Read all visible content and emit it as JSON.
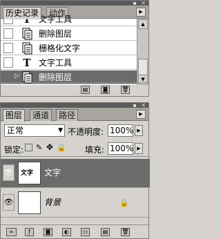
{
  "history": {
    "tabs": [
      "历史记录",
      "动作"
    ],
    "items": [
      {
        "label": "文字工具",
        "icon": "type-tool-icon",
        "selected": false
      },
      {
        "label": "删除图层",
        "icon": "document-icon",
        "selected": false
      },
      {
        "label": "栅格化文字",
        "icon": "document-icon",
        "selected": false
      },
      {
        "label": "文字工具",
        "icon": "type-tool-icon",
        "selected": false
      },
      {
        "label": "删除图层",
        "icon": "document-icon",
        "selected": true
      }
    ]
  },
  "layers": {
    "tabs": [
      "图层",
      "通道",
      "路径"
    ],
    "blend_mode": "正常",
    "opacity_label": "不透明度:",
    "opacity_value": "100%",
    "lock_label": "锁定:",
    "fill_label": "填充:",
    "fill_value": "100%",
    "items": [
      {
        "name": "文字",
        "thumb_text": "文字",
        "selected": true
      },
      {
        "name": "背景",
        "selected": false,
        "locked": true
      }
    ]
  },
  "colors": {
    "selected_row": "#6b6b6b",
    "panel_bg": "#d6d3ce"
  }
}
